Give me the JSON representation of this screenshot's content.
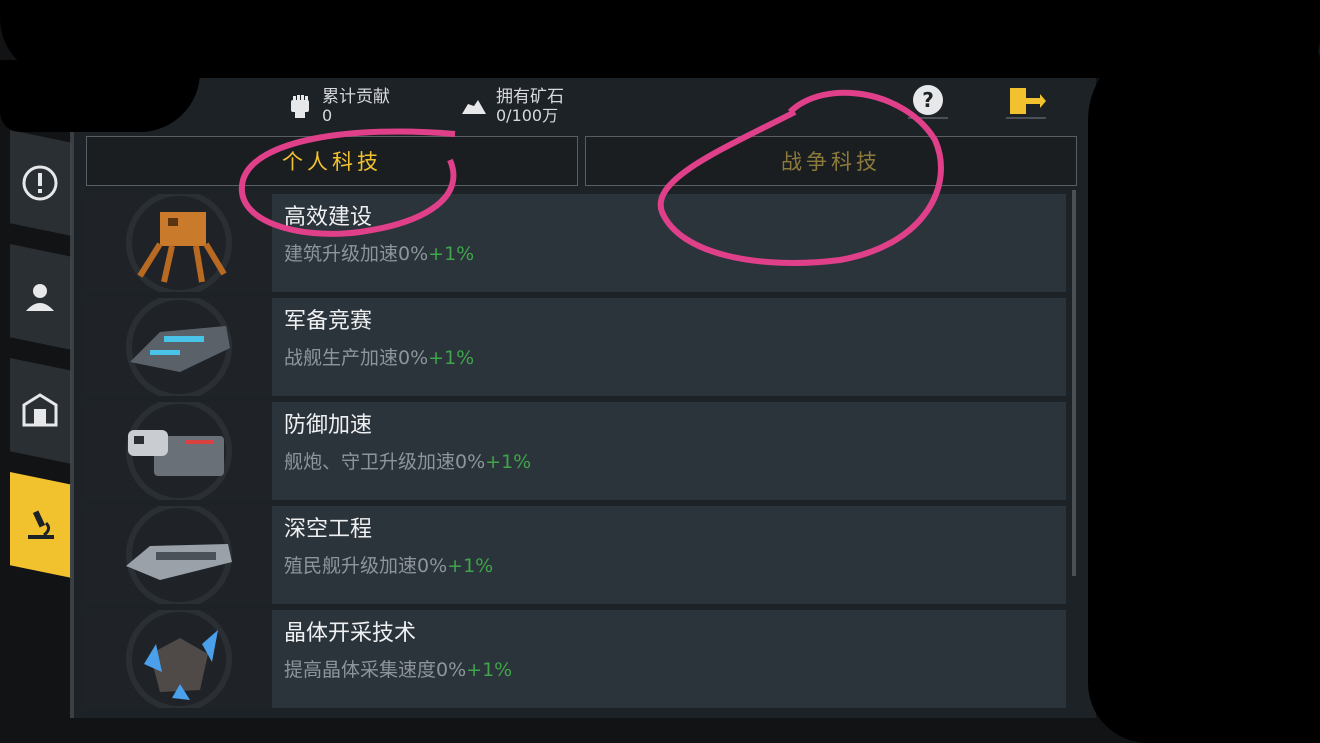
{
  "header": {
    "contribution": {
      "label": "累计贡献",
      "value": "0",
      "icon": "fist-icon"
    },
    "ore": {
      "label": "拥有矿石",
      "value": "0/100万",
      "icon": "ore-icon"
    },
    "help_icon": "question-icon",
    "exit_icon": "exit-door-icon"
  },
  "sidebar": {
    "items": [
      {
        "icon": "alert-icon"
      },
      {
        "icon": "person-icon"
      },
      {
        "icon": "building-icon"
      },
      {
        "icon": "microscope-icon",
        "active": true
      }
    ]
  },
  "tabs": {
    "personal": "个人科技",
    "war": "战争科技"
  },
  "techs": [
    {
      "title": "高效建设",
      "desc": "建筑升级加速0%",
      "bonus": "+1%",
      "icon": "mech-walker-icon"
    },
    {
      "title": "军备竞赛",
      "desc": "战舰生产加速0%",
      "bonus": "+1%",
      "icon": "battleship-icon"
    },
    {
      "title": "防御加速",
      "desc": "舰炮、守卫升级加速0%",
      "bonus": "+1%",
      "icon": "turret-icon"
    },
    {
      "title": "深空工程",
      "desc": "殖民舰升级加速0%",
      "bonus": "+1%",
      "icon": "colony-ship-icon"
    },
    {
      "title": "晶体开采技术",
      "desc": "提高晶体采集速度0%",
      "bonus": "+1%",
      "icon": "crystal-icon"
    }
  ],
  "colors": {
    "accent": "#f2c12e",
    "bonus": "#3fa44a",
    "annotation": "#e0408a"
  }
}
